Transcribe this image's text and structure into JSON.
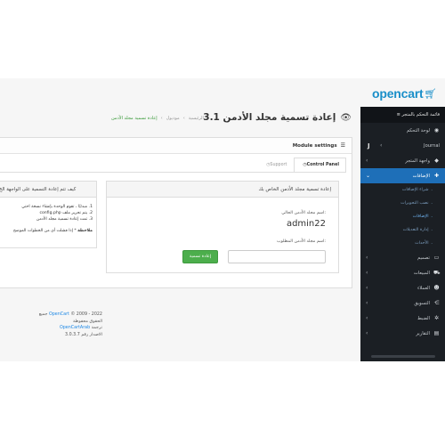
{
  "logo": {
    "text": "opencart",
    "cart_icon": "cart-icon"
  },
  "sidebar": {
    "header": "≡ قائمة التحكم بالمتجر",
    "items": [
      {
        "label": "لوحة التحكم",
        "icon": "dashboard-icon",
        "glyph": "◉"
      },
      {
        "label": "Journal",
        "icon": "journal-icon",
        "glyph": "J"
      },
      {
        "label": "واجهة المتجر",
        "icon": "tag-icon",
        "glyph": "◆"
      },
      {
        "label": "الإضافات",
        "icon": "puzzle-icon",
        "glyph": "✚"
      }
    ],
    "subitems": [
      "شراء الإضافات",
      "نصب التحويرات",
      "الإضافات",
      "إدارة التعديلات",
      "الأحداث"
    ],
    "items2": [
      {
        "label": "تصميم",
        "icon": "desktop-icon",
        "glyph": "▭"
      },
      {
        "label": "المبيعات",
        "icon": "shopping-cart-icon",
        "glyph": "⛟"
      },
      {
        "label": "العملاء",
        "icon": "user-icon",
        "glyph": "☻"
      },
      {
        "label": "التسويق",
        "icon": "share-icon",
        "glyph": "⋲"
      },
      {
        "label": "الضبط",
        "icon": "cog-icon",
        "glyph": "✲"
      },
      {
        "label": "التقارير",
        "icon": "bar-chart-icon",
        "glyph": "▤"
      }
    ]
  },
  "header": {
    "title": "إعادة تسمية مجلد الأدمن 3.1",
    "breadcrumb": [
      "الرئيسية",
      "موديول",
      "إعادة تسمية مجلد الأدمن"
    ]
  },
  "panel": {
    "title": "Module settings",
    "tabs": [
      "Control Panel",
      "Support"
    ]
  },
  "rename_card": {
    "title": "إعادة تسمية مجلد الأدمن الخاص بك",
    "current_label": "اسم مجلد الأدمن الحالي:",
    "current_value": "admin22",
    "new_label": "اسم مجلد الأدمن المطلوب:",
    "new_value": "",
    "button": "إعادة تسمية"
  },
  "howto_card": {
    "title": "كيف تتم إعادة التسمية على الواجهة الخ",
    "steps": [
      "1. مبدئيًا ، تقوم الوحدة بإنشاء نسخة احتي",
      "2. يتم تحرير ملف config.php",
      "3. تمت إعادة تسمية مجلد الأدمن"
    ],
    "note_label": "ملاحظة",
    "note_text": "* إذا فشلت أي من الخطوات الموضح"
  },
  "footer": {
    "line1_link": "OpenCart",
    "line1_text": "© 2009 - 2022 جميع الحقوق محفوظة",
    "line2_prefix": "ترجمة",
    "line2_link": "OpenCartArab",
    "line3": "الاصدار رقم 3.0.3.7"
  }
}
